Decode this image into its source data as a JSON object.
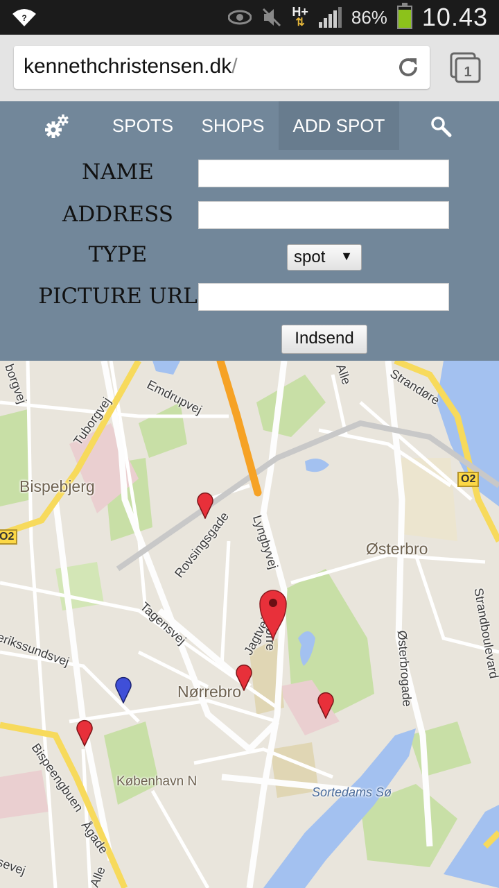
{
  "status_bar": {
    "network": "H+",
    "battery_percent": "86%",
    "battery_level": 0.86,
    "time": "10.43"
  },
  "browser": {
    "url_host": "kennethchristensen.dk",
    "url_path": "/",
    "tab_count": "1"
  },
  "nav": {
    "items": [
      {
        "label": "SPOTS"
      },
      {
        "label": "SHOPS"
      },
      {
        "label": "ADD SPOT"
      }
    ],
    "active_item": "ADD SPOT"
  },
  "form": {
    "name_label": "NAME",
    "name_value": "",
    "address_label": "ADDRESS",
    "address_value": "",
    "type_label": "TYPE",
    "type_selected": "spot",
    "picture_label": "PICTURE URL",
    "picture_value": "",
    "submit_label": "Indsend"
  },
  "map": {
    "districts": [
      "Bispebjerg",
      "Østerbro",
      "Nørrebro",
      "København N"
    ],
    "streets": [
      "Emdrupvej",
      "Tuborgvej",
      "Strandøre",
      "Alle",
      "borgvej",
      "Rovsingsgade",
      "Lyngbyvej",
      "Tagensvej",
      "Jagtvej",
      "Nørre",
      "Østerbrogade",
      "Strandboulevard",
      "erikssundsvej",
      "Bispeengbuen",
      "Ågade",
      "Alle",
      "sevej"
    ],
    "water_labels": [
      "Sortedams Sø"
    ],
    "road_shields": [
      "O2",
      "O2"
    ],
    "markers": [
      {
        "type": "spot",
        "color": "#e8303a"
      },
      {
        "type": "spot",
        "color": "#e8303a"
      },
      {
        "type": "spot",
        "color": "#e8303a"
      },
      {
        "type": "spot",
        "color": "#e8303a"
      },
      {
        "type": "shop",
        "color": "#3f4fd8"
      },
      {
        "type": "selected",
        "color": "#e8303a"
      }
    ]
  },
  "colors": {
    "panel_bg": "#72879a",
    "active_tab_bg": "#687c8e",
    "map_land": "#e9e5dc",
    "map_park": "#c8dfa6",
    "map_water": "#a3c1f0",
    "major_road": "#f6a225"
  }
}
